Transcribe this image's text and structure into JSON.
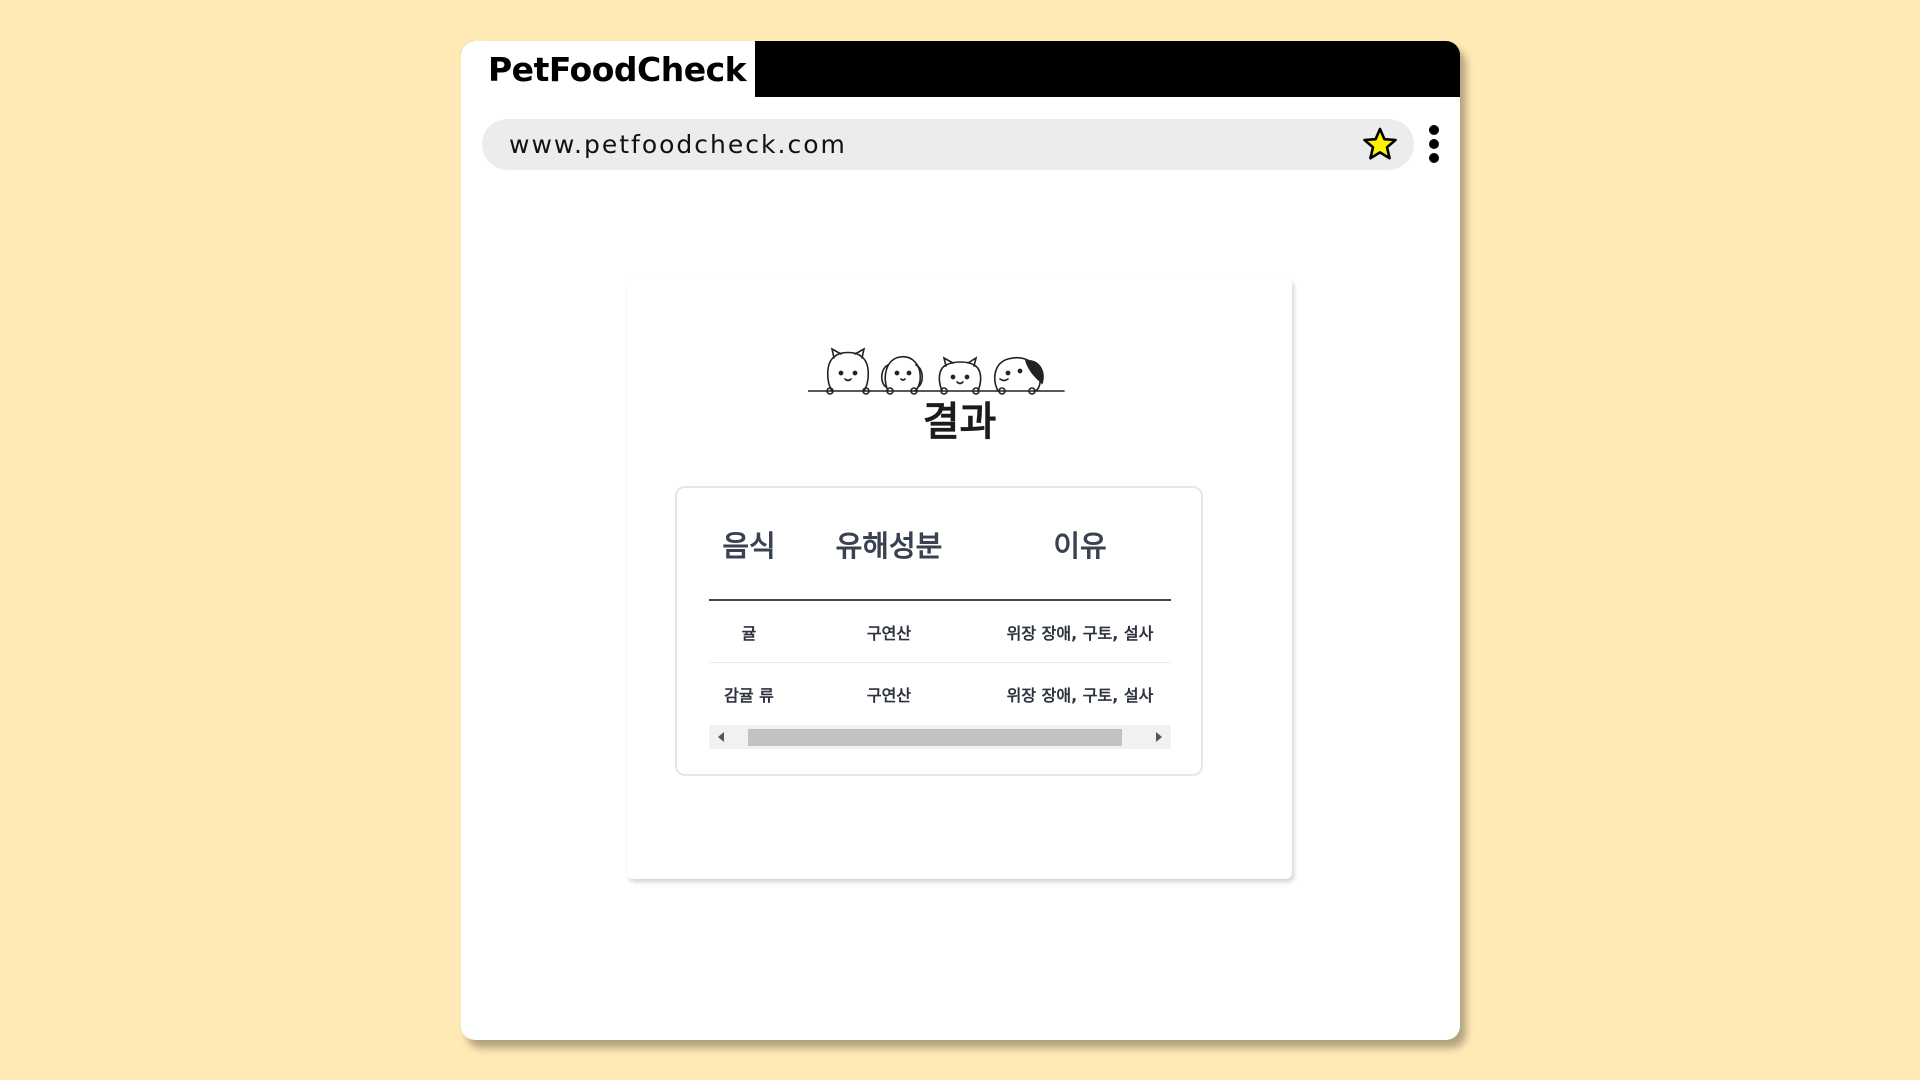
{
  "browser": {
    "tab_title": "PetFoodCheck",
    "url": "www.petfoodcheck.com",
    "icons": {
      "bookmark": "star-icon",
      "menu": "kebab-menu-icon"
    }
  },
  "colors": {
    "page_background": "#FFE9B4",
    "tab_bar": "#000000",
    "address_bar": "#ECECEC",
    "star_fill": "#FFF200",
    "table_header_text": "#3a4150"
  },
  "page": {
    "title": "결과",
    "illustration": "peeking-pets-illustration"
  },
  "results_table": {
    "headers": [
      "음식",
      "유해성분",
      "이유"
    ],
    "rows": [
      {
        "food": "귤",
        "ingredient": "구연산",
        "reason": "위장 장애, 구토, 설사"
      },
      {
        "food": "감귤 류",
        "ingredient": "구연산",
        "reason": "위장 장애, 구토, 설사"
      }
    ]
  }
}
